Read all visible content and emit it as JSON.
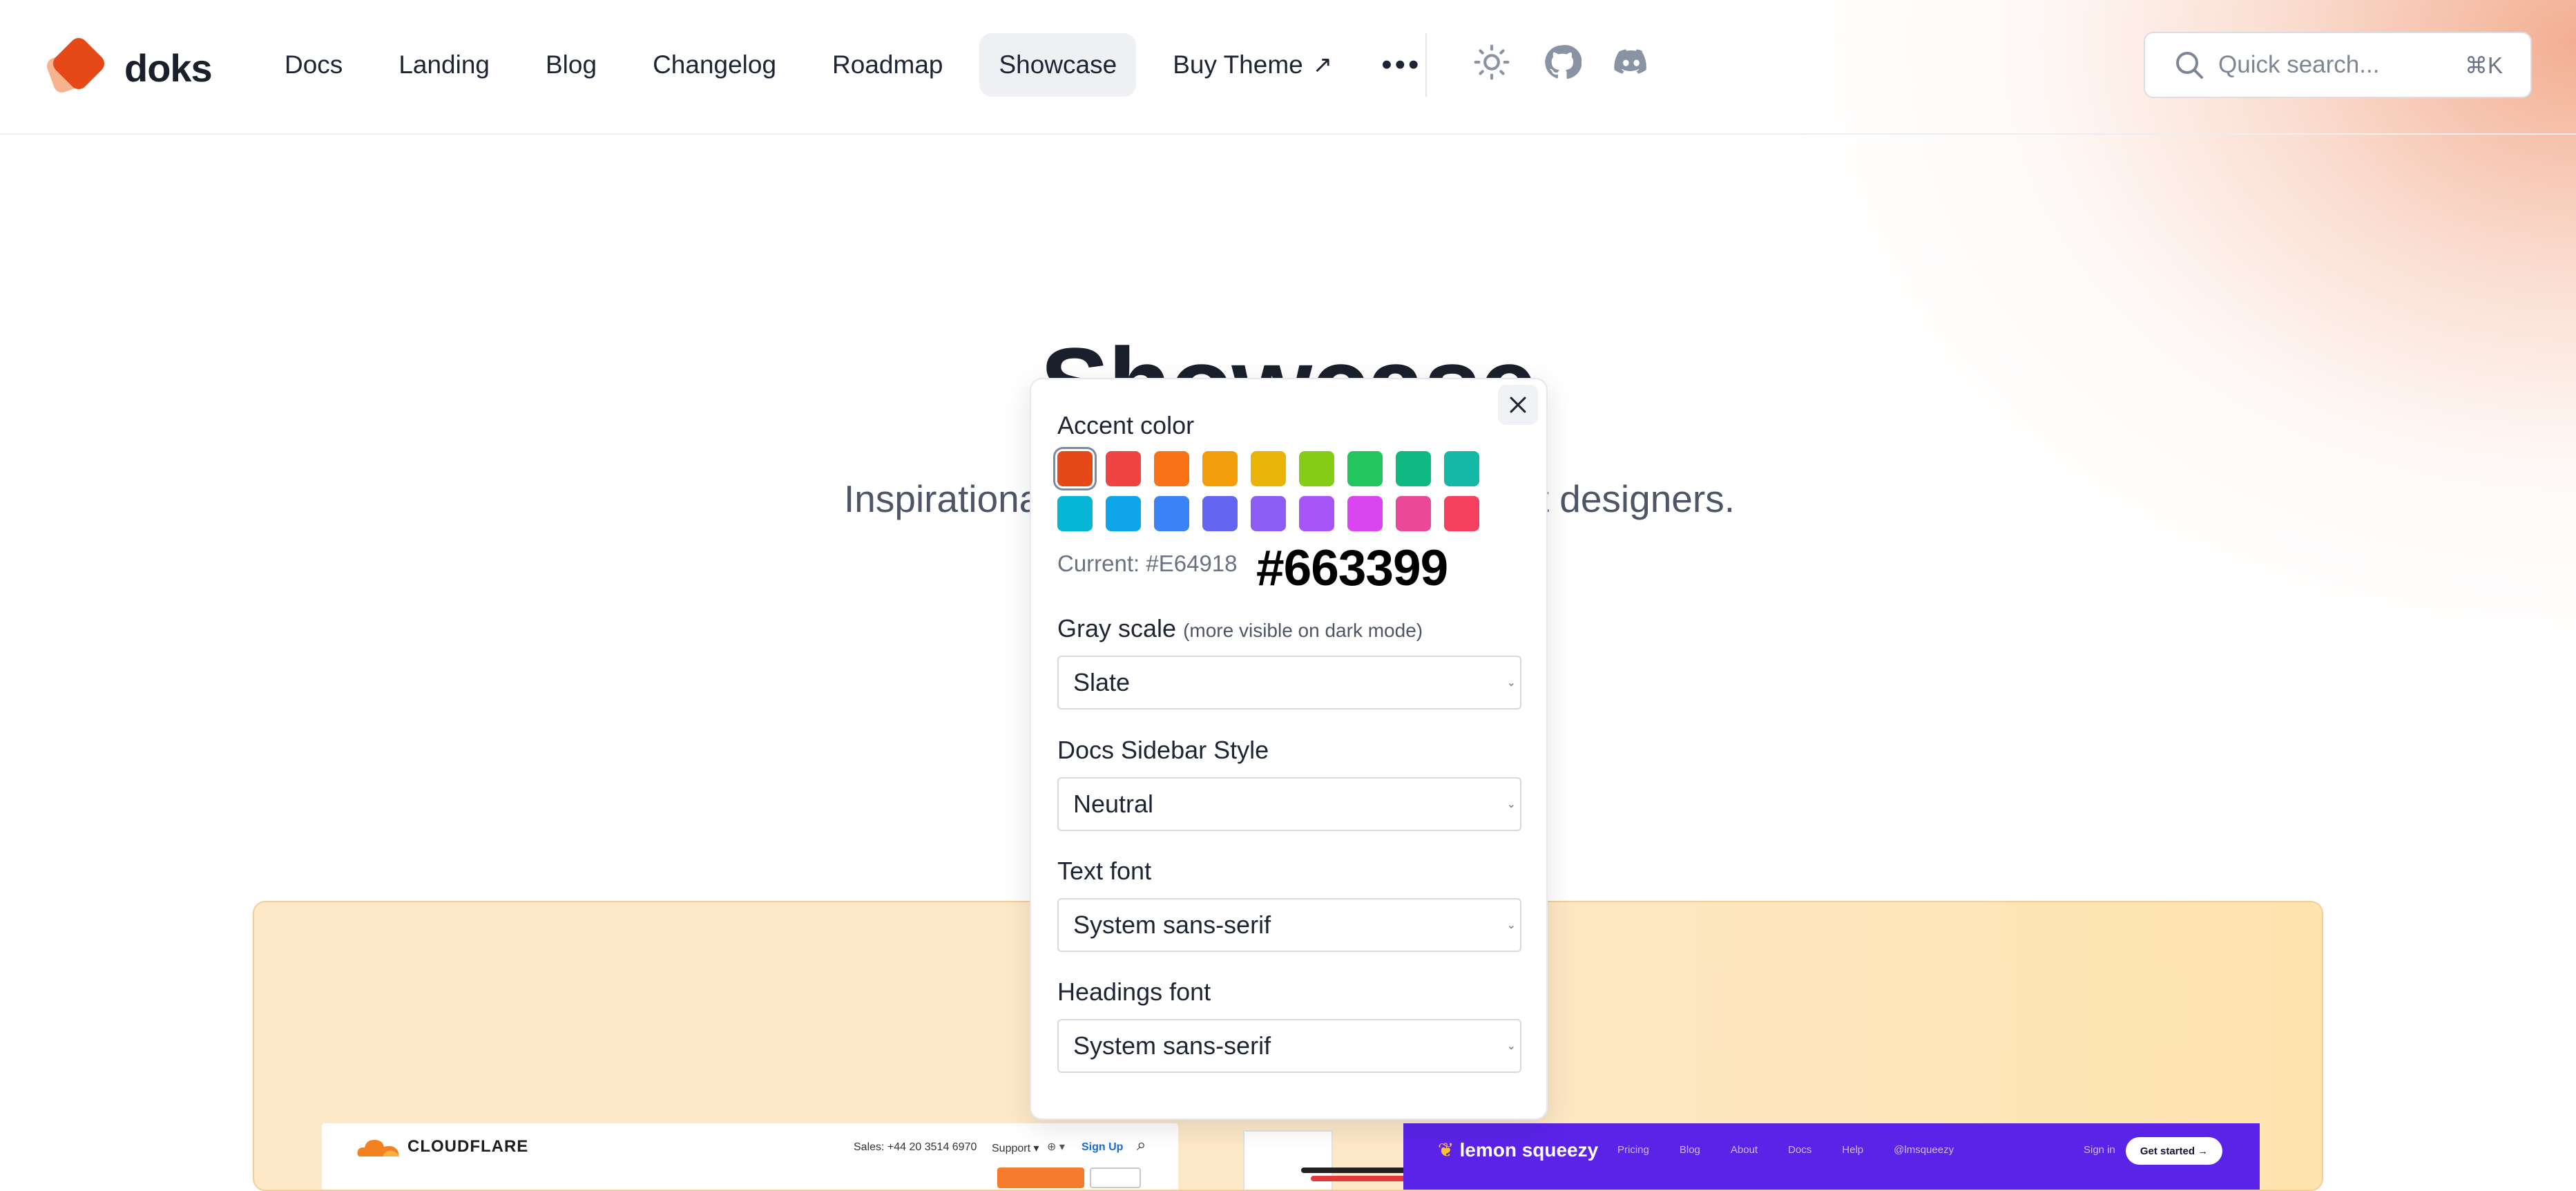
{
  "header": {
    "brand": "doks",
    "nav": [
      {
        "label": "Docs"
      },
      {
        "label": "Landing"
      },
      {
        "label": "Blog"
      },
      {
        "label": "Changelog"
      },
      {
        "label": "Roadmap"
      },
      {
        "label": "Showcase",
        "active": true
      },
      {
        "label": "Buy Theme",
        "external": true
      }
    ],
    "more_icon": "ellipsis-icon",
    "icons": [
      "sun-icon",
      "github-icon",
      "discord-icon"
    ],
    "search": {
      "placeholder": "Quick search...",
      "shortcut": "⌘K"
    }
  },
  "hero": {
    "title": "Showcase",
    "subtitle_left": "Inspirational",
    "subtitle_right": "t designers."
  },
  "showcase": {
    "cloudflare": {
      "logo": "CLOUDFLARE",
      "sales": "Sales: +44 20 3514 6970",
      "support": "Support ▾",
      "globe": "⊕ ▾",
      "signup": "Sign Up"
    },
    "lemonsqueezy": {
      "logo": "lemon squeezy",
      "nav": [
        "Pricing",
        "Blog",
        "About",
        "Docs",
        "Help",
        "@lmsqueezy"
      ],
      "signin": "Sign in",
      "cta": "Get started →"
    }
  },
  "settings": {
    "accent_label": "Accent color",
    "swatches": [
      "#E64918",
      "#EF4444",
      "#F97316",
      "#F59E0B",
      "#EAB308",
      "#84CC16",
      "#22C55E",
      "#10B981",
      "#14B8A6",
      "#06B6D4",
      "#0EA5E9",
      "#3B82F6",
      "#6366F1",
      "#8B5CF6",
      "#A855F7",
      "#D946EF",
      "#EC4899",
      "#F43F5E"
    ],
    "selected_swatch": 0,
    "current_text": "Current: #E64918",
    "hex_display": "#663399",
    "gray_scale_label": "Gray scale",
    "gray_scale_hint": "(more visible on dark mode)",
    "gray_scale_value": "Slate",
    "sidebar_style_label": "Docs Sidebar Style",
    "sidebar_style_value": "Neutral",
    "text_font_label": "Text font",
    "text_font_value": "System sans-serif",
    "headings_font_label": "Headings font",
    "headings_font_value": "System sans-serif"
  },
  "colors": {
    "accent": "#E64918",
    "nav_active_bg": "#EEF0F4",
    "showcase_panel": "#FDE8C8",
    "lemonsqueezy_purple": "#5B23E8"
  }
}
